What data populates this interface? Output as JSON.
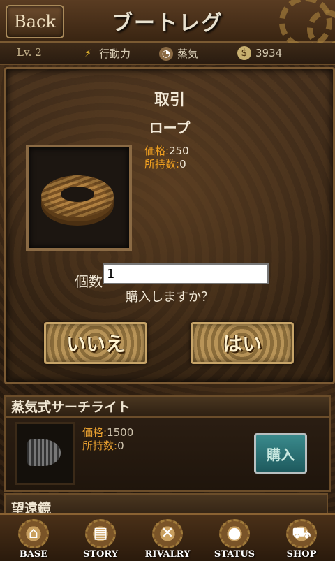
{
  "header": {
    "back_label": "Back",
    "title": "ブートレグ"
  },
  "status": {
    "level_label": "Lv. 2",
    "action_label": "行動力",
    "steam_label": "蒸気",
    "money_value": "3934"
  },
  "dialog": {
    "title": "取引",
    "item_name": "ロープ",
    "price_key": "価格:",
    "price_value": "250",
    "owned_key": "所持数:",
    "owned_value": "0",
    "qty_label": "個数",
    "qty_value": "1",
    "confirm_text": "購入しますか？",
    "no_label": "いいえ",
    "yes_label": "はい"
  },
  "shop_items": [
    {
      "name": "蒸気式サーチライト",
      "price_key": "価格:",
      "price_value": "1500",
      "owned_key": "所持数:",
      "owned_value": "0",
      "buy_label": "購入"
    },
    {
      "name": "望遠鏡"
    }
  ],
  "nav": [
    {
      "label": "BASE",
      "icon": "house-icon"
    },
    {
      "label": "STORY",
      "icon": "book-icon"
    },
    {
      "label": "RIVALRY",
      "icon": "crossed-swords-icon"
    },
    {
      "label": "STATUS",
      "icon": "person-icon"
    },
    {
      "label": "SHOP",
      "icon": "cart-icon"
    }
  ]
}
